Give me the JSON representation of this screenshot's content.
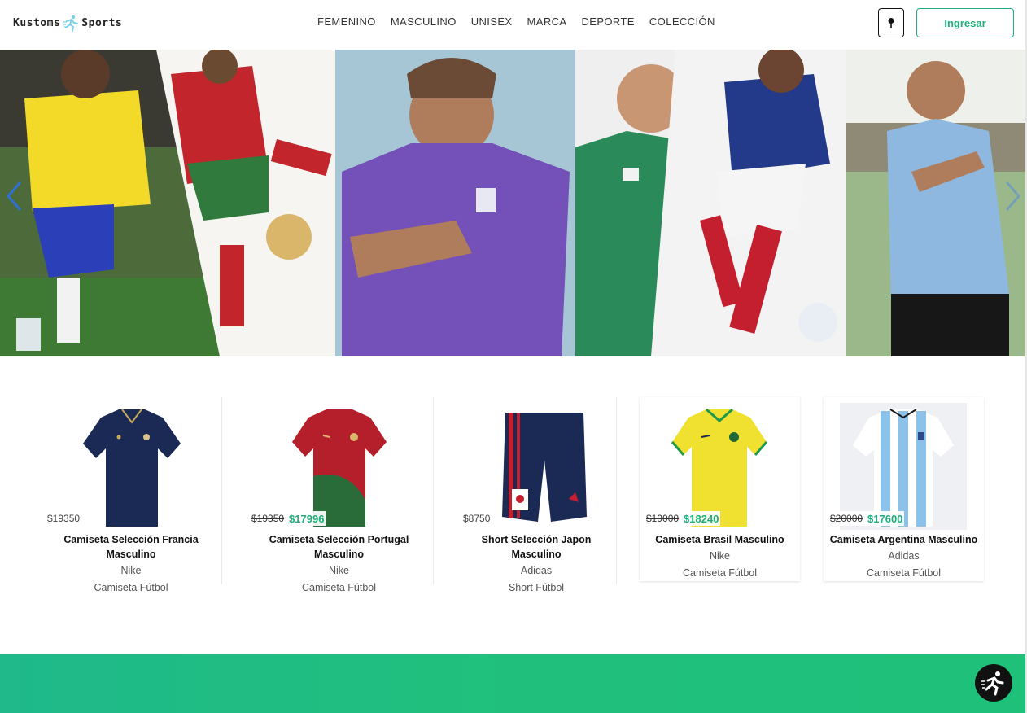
{
  "header": {
    "logo_left": "Kustoms",
    "logo_right": "Sports",
    "nav": [
      "FEMENINO",
      "MASCULINO",
      "UNISEX",
      "MARCA",
      "DEPORTE",
      "COLECCIÓN"
    ],
    "location_icon": "location-pin-icon",
    "login_label": "Ingresar"
  },
  "hero": {
    "icons": {
      "prev": "chevron-left-icon",
      "next": "chevron-right-icon"
    }
  },
  "products": [
    {
      "price": "$19350",
      "old_price": "",
      "new_price": "",
      "title": "Camiseta Selección Francia Masculino",
      "brand": "Nike",
      "category": "Camiseta Fútbol"
    },
    {
      "price": "",
      "old_price": "$19350",
      "new_price": "$17996",
      "title": "Camiseta Selección Portugal Masculino",
      "brand": "Nike",
      "category": "Camiseta Fútbol"
    },
    {
      "price": "$8750",
      "old_price": "",
      "new_price": "",
      "title": "Short Selección Japon Masculino",
      "brand": "Adidas",
      "category": "Short Fútbol"
    },
    {
      "price": "",
      "old_price": "$19000",
      "new_price": "$18240",
      "title": "Camiseta Brasil Masculino",
      "brand": "Nike",
      "category": "Camiseta Fútbol"
    },
    {
      "price": "",
      "old_price": "$20000",
      "new_price": "$17600",
      "title": "Camiseta Argentina Masculino",
      "brand": "Adidas",
      "category": "Camiseta Fútbol"
    }
  ],
  "colors": {
    "accent": "#1fae7a",
    "band": "#1fb98a"
  },
  "fab_icon": "runner-icon"
}
